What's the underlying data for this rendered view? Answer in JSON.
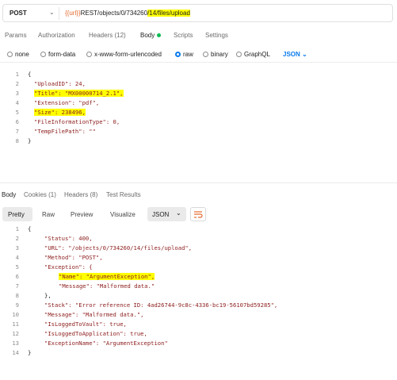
{
  "request": {
    "method": "POST",
    "url_var": "{{url}}",
    "url_path": "REST/objects/0/734260",
    "url_highlight": "/14/files/upload"
  },
  "req_tabs": [
    "Params",
    "Authorization",
    "Headers (12)",
    "Body",
    "Scripts",
    "Settings"
  ],
  "body_types": [
    "none",
    "form-data",
    "x-www-form-urlencoded",
    "raw",
    "binary",
    "GraphQL"
  ],
  "body_format": "JSON",
  "request_body": {
    "line_numbers": [
      "1",
      "2",
      "3",
      "4",
      "5",
      "6",
      "7",
      "8"
    ],
    "lines": [
      "{",
      "\"UploadID\": 24,",
      "\"Title\": \"MX00000714_2.1\",",
      "\"Extension\": \"pdf\",",
      "\"Size\": 238496,",
      "\"FileInformationType\": 0,",
      "\"TempFilePath\": \"\"",
      "}"
    ]
  },
  "resp_tabs": [
    "Body",
    "Cookies (1)",
    "Headers (8)",
    "Test Results"
  ],
  "resp_view": [
    "Pretty",
    "Raw",
    "Preview",
    "Visualize"
  ],
  "resp_format": "JSON",
  "response_body": {
    "line_numbers": [
      "1",
      "2",
      "3",
      "4",
      "5",
      "6",
      "7",
      "8",
      "9",
      "10",
      "11",
      "12",
      "13",
      "14"
    ],
    "lines": [
      "{",
      "\"Status\": 400,",
      "\"URL\": \"/objects/0/734260/14/files/upload\",",
      "\"Method\": \"POST\",",
      "\"Exception\": {",
      "\"Name\": \"ArgumentException\",",
      "\"Message\": \"Malformed data.\"",
      "},",
      "\"Stack\": \"Error reference ID: 4ad26744-9c8c-4336-bc19-56107bd59285\",",
      "\"Message\": \"Malformed data.\",",
      "\"IsLoggedToVault\": true,",
      "\"IsLoggedToApplication\": true,",
      "\"ExceptionName\": \"ArgumentException\"",
      "}"
    ]
  }
}
